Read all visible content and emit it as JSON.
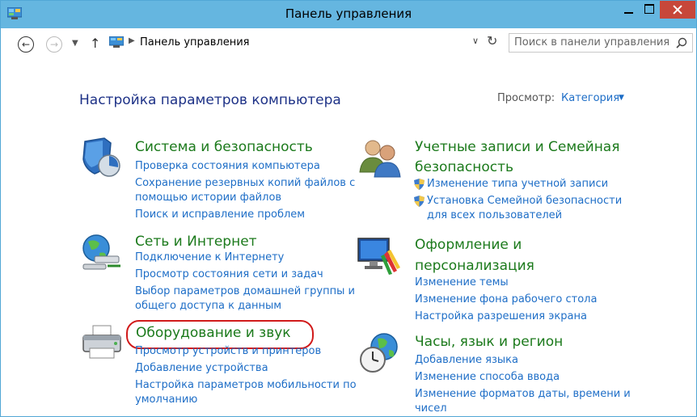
{
  "window": {
    "title": "Панель управления"
  },
  "address": {
    "breadcrumb": "Панель управления",
    "search_placeholder": "Поиск в панели управления"
  },
  "header": {
    "heading": "Настройка параметров компьютера",
    "view_label": "Просмотр:",
    "view_value": "Категория"
  },
  "categories": [
    {
      "title": "Система и безопасность",
      "links": [
        "Проверка состояния компьютера",
        "Сохранение резервных копий файлов с",
        "помощью истории файлов",
        "Поиск и исправление проблем"
      ]
    },
    {
      "title": "Сеть и Интернет",
      "links": [
        "Подключение к Интернету",
        "Просмотр состояния сети и задач",
        "Выбор параметров домашней группы и",
        "общего доступа к данным"
      ]
    },
    {
      "title": "Оборудование и звук",
      "links": [
        "Просмотр устройств и принтеров",
        "Добавление устройства",
        "Настройка параметров мобильности по",
        "умолчанию"
      ]
    },
    {
      "title_lines": [
        "Учетные записи и Семейная",
        "безопасность"
      ],
      "links": [
        "Изменение типа учетной записи",
        "Установка Семейной безопасности",
        "для всех пользователей"
      ]
    },
    {
      "title_lines": [
        "Оформление и",
        "персонализация"
      ],
      "links": [
        "Изменение темы",
        "Изменение фона рабочего стола",
        "Настройка разрешения экрана"
      ]
    },
    {
      "title": "Часы, язык и регион",
      "links": [
        "Добавление языка",
        "Изменение способа ввода",
        "Изменение форматов даты, времени и",
        "чисел"
      ]
    }
  ],
  "colors": {
    "titlebar": "#65b6e0",
    "heading": "#1e3287",
    "category_title": "#1c7a1c",
    "link": "#1e6ec7",
    "highlight": "#d11b1b",
    "close_button": "#c7473a"
  }
}
